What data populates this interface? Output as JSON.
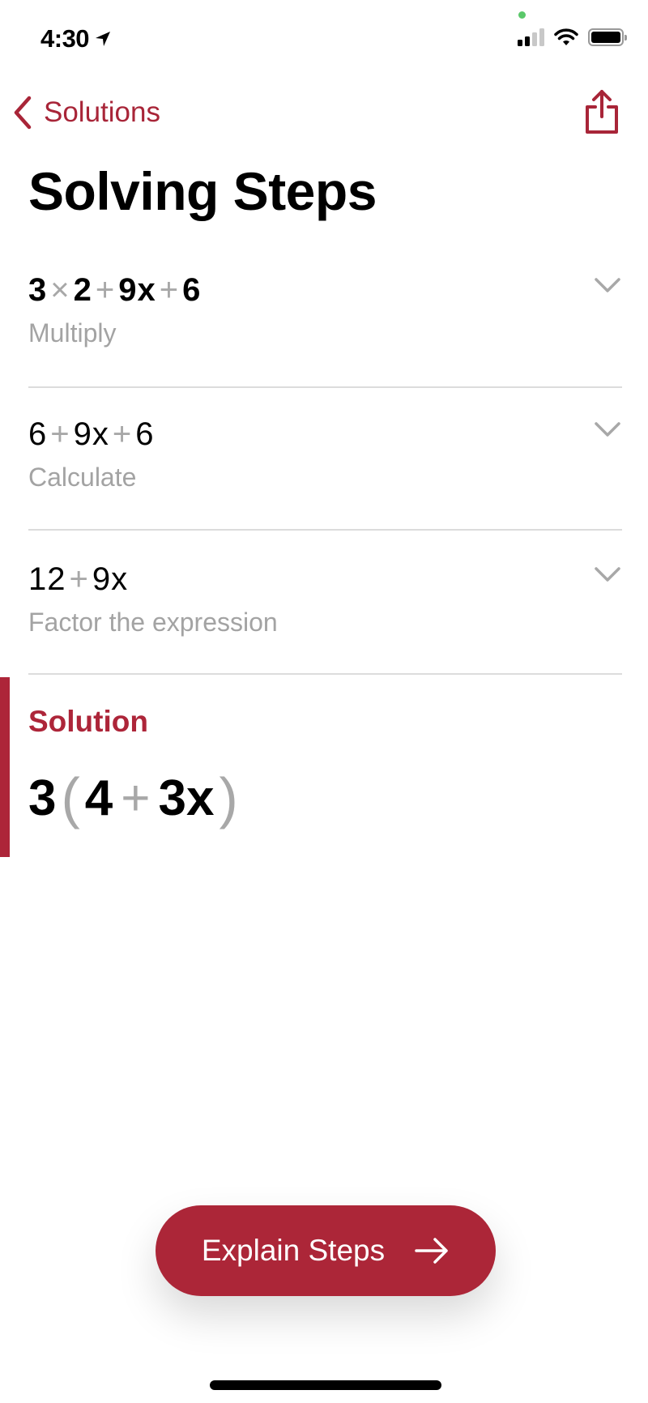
{
  "status_bar": {
    "time": "4:30",
    "location_icon": "location-arrow-icon",
    "signal_icon": "cellular-signal-icon",
    "wifi_icon": "wifi-icon",
    "battery_icon": "battery-icon",
    "signal_bars_active": 2,
    "signal_bars_total": 4
  },
  "nav": {
    "back_label": "Solutions",
    "back_icon": "chevron-left-icon",
    "share_icon": "share-icon"
  },
  "title": "Solving Steps",
  "steps": [
    {
      "expression_tokens": [
        {
          "t": "3",
          "op": false
        },
        {
          "t": "×",
          "op": true
        },
        {
          "t": "2",
          "op": false
        },
        {
          "t": "+",
          "op": true
        },
        {
          "t": "9x",
          "op": false
        },
        {
          "t": "+",
          "op": true
        },
        {
          "t": "6",
          "op": false
        }
      ],
      "expression": "3 × 2 + 9x + 6",
      "description": "Multiply",
      "bold": true
    },
    {
      "expression_tokens": [
        {
          "t": "6",
          "op": false
        },
        {
          "t": "+",
          "op": true
        },
        {
          "t": "9x",
          "op": false
        },
        {
          "t": "+",
          "op": true
        },
        {
          "t": "6",
          "op": false
        }
      ],
      "expression": "6 + 9x + 6",
      "description": "Calculate",
      "bold": false
    },
    {
      "expression_tokens": [
        {
          "t": "12",
          "op": false
        },
        {
          "t": "+",
          "op": true
        },
        {
          "t": "9x",
          "op": false
        }
      ],
      "expression": "12 + 9x",
      "description": "Factor the expression",
      "bold": false
    }
  ],
  "solution": {
    "label": "Solution",
    "expression": "3(4 + 3x)",
    "parts": {
      "coef": "3",
      "open": "(",
      "a": "4",
      "op": "+",
      "b": "3x",
      "close": ")"
    }
  },
  "explain_button": {
    "label": "Explain Steps",
    "icon": "arrow-right-icon"
  },
  "colors": {
    "accent": "#ad2539",
    "muted_text": "#a3a3a3",
    "divider": "#dcdcdc"
  }
}
